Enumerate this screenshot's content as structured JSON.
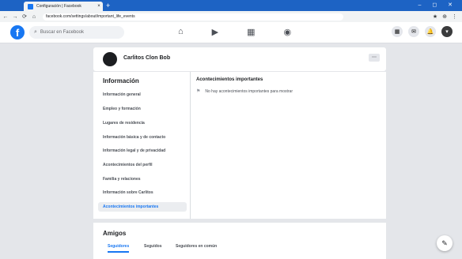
{
  "browser": {
    "tab_title": "Configuración | Facebook",
    "tab_close": "×",
    "new_tab": "+",
    "window_controls": "– ◻ ✕",
    "nav": {
      "back": "←",
      "forward": "→",
      "reload": "⟳",
      "home": "⌂"
    },
    "url": "facebook.com/settings/about/important_life_events",
    "extensions": [
      "★",
      "⊕",
      "⋮"
    ]
  },
  "fb": {
    "logo": "f",
    "search_placeholder": "Buscar en Facebook",
    "nav_icons": [
      "home-icon",
      "watch-icon",
      "marketplace-icon",
      "groups-icon"
    ],
    "nav_glyphs": [
      "⌂",
      "▶",
      "▦",
      "◉"
    ],
    "right_glyphs": [
      "▦",
      "✉",
      "🔔",
      "▾"
    ]
  },
  "profile": {
    "name": "Carlitos Clon Bob",
    "more": "⋯"
  },
  "about": {
    "heading": "Información",
    "items": [
      "Información general",
      "Empleo y formación",
      "Lugares de residencia",
      "Información básica y de contacto",
      "Información legal y de privacidad",
      "Acontecimientos del perfil",
      "Familia y relaciones",
      "Información sobre Carlitos",
      "Acontecimientos importantes"
    ],
    "section_title": "Acontecimientos importantes",
    "empty_text": "No hay acontecimientos importantes para mostrar"
  },
  "friends": {
    "heading": "Amigos",
    "tabs": [
      "Seguidores",
      "Seguidos",
      "Seguidores en común"
    ]
  },
  "colors": {
    "brand": "#1877f2",
    "chrome": "#1d63c4"
  }
}
